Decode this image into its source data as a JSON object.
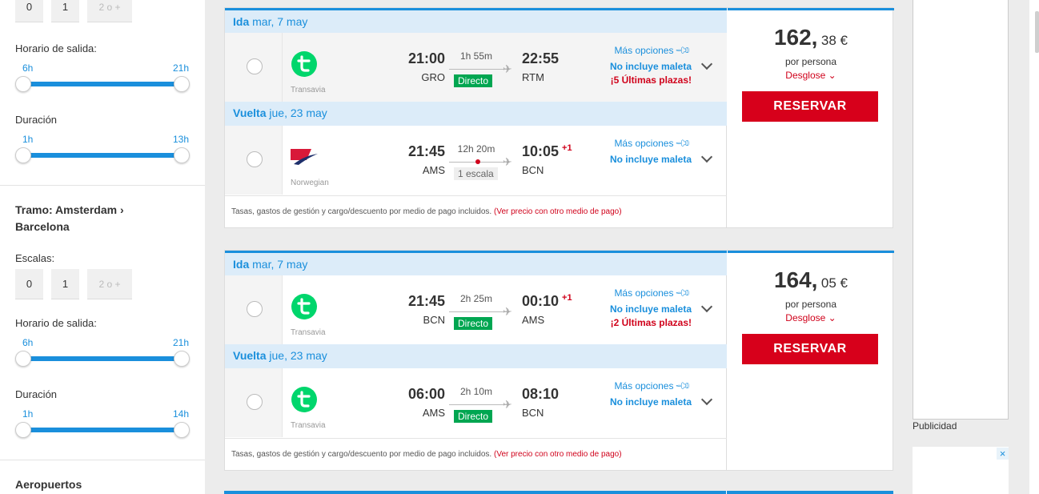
{
  "sidebar": {
    "top_stops": [
      "0",
      "1",
      "2 o +"
    ],
    "top_departure": {
      "label": "Horario de salida:",
      "min": "6h",
      "max": "21h"
    },
    "top_duration": {
      "label": "Duración",
      "min": "1h",
      "max": "13h"
    },
    "leg_title": "Tramo: Amsterdam › Barcelona",
    "stops_label": "Escalas:",
    "stops": [
      "0",
      "1",
      "2 o +"
    ],
    "departure": {
      "label": "Horario de salida:",
      "min": "6h",
      "max": "21h"
    },
    "duration": {
      "label": "Duración",
      "min": "1h",
      "max": "14h"
    },
    "airports_title": "Aeropuertos"
  },
  "results": [
    {
      "legs": [
        {
          "direction": "Ida",
          "date": "mar, 7 may",
          "airline": "Transavia",
          "logo": "transavia-logo",
          "dep_time": "21:00",
          "dep_code": "GRO",
          "duration": "1h 55m",
          "stops": "Directo",
          "direct": true,
          "arr_time": "22:55",
          "arr_code": "RTM",
          "plus_day": "",
          "more_options": "Más opciones",
          "baggage": "No incluye maleta",
          "seats_warning": "¡5 Últimas plazas!"
        },
        {
          "direction": "Vuelta",
          "date": "jue, 23 may",
          "airline": "Norwegian",
          "logo": "norwegian-logo",
          "dep_time": "21:45",
          "dep_code": "AMS",
          "duration": "12h 20m",
          "stops": "1 escala",
          "direct": false,
          "arr_time": "10:05",
          "arr_code": "BCN",
          "plus_day": "+1",
          "more_options": "Más opciones",
          "baggage": "No incluye maleta",
          "seats_warning": ""
        }
      ],
      "price_int": "162,",
      "price_dec": "38 €",
      "per_person": "por persona",
      "breakdown": "Desglose ⌄",
      "reserve": "RESERVAR",
      "fees": "Tasas, gastos de gestión y cargo/descuento por medio de pago incluidos.",
      "fees_link": "(Ver precio con otro medio de pago)"
    },
    {
      "legs": [
        {
          "direction": "Ida",
          "date": "mar, 7 may",
          "airline": "Transavia",
          "logo": "transavia-logo",
          "dep_time": "21:45",
          "dep_code": "BCN",
          "duration": "2h 25m",
          "stops": "Directo",
          "direct": true,
          "arr_time": "00:10",
          "arr_code": "AMS",
          "plus_day": "+1",
          "more_options": "Más opciones",
          "baggage": "No incluye maleta",
          "seats_warning": "¡2 Últimas plazas!"
        },
        {
          "direction": "Vuelta",
          "date": "jue, 23 may",
          "airline": "Transavia",
          "logo": "transavia-logo",
          "dep_time": "06:00",
          "dep_code": "AMS",
          "duration": "2h 10m",
          "stops": "Directo",
          "direct": true,
          "arr_time": "08:10",
          "arr_code": "BCN",
          "plus_day": "",
          "more_options": "Más opciones",
          "baggage": "No incluye maleta",
          "seats_warning": ""
        }
      ],
      "price_int": "164,",
      "price_dec": "05 €",
      "per_person": "por persona",
      "breakdown": "Desglose ⌄",
      "reserve": "RESERVAR",
      "fees": "Tasas, gastos de gestión y cargo/descuento por medio de pago incluidos.",
      "fees_link": "(Ver precio con otro medio de pago)"
    }
  ],
  "ad": {
    "label": "Publicidad",
    "close": "×"
  },
  "colors": {
    "accent": "#1a8fdc",
    "danger": "#d7001b",
    "direct": "#00a651",
    "transavia": "#00d66c"
  }
}
